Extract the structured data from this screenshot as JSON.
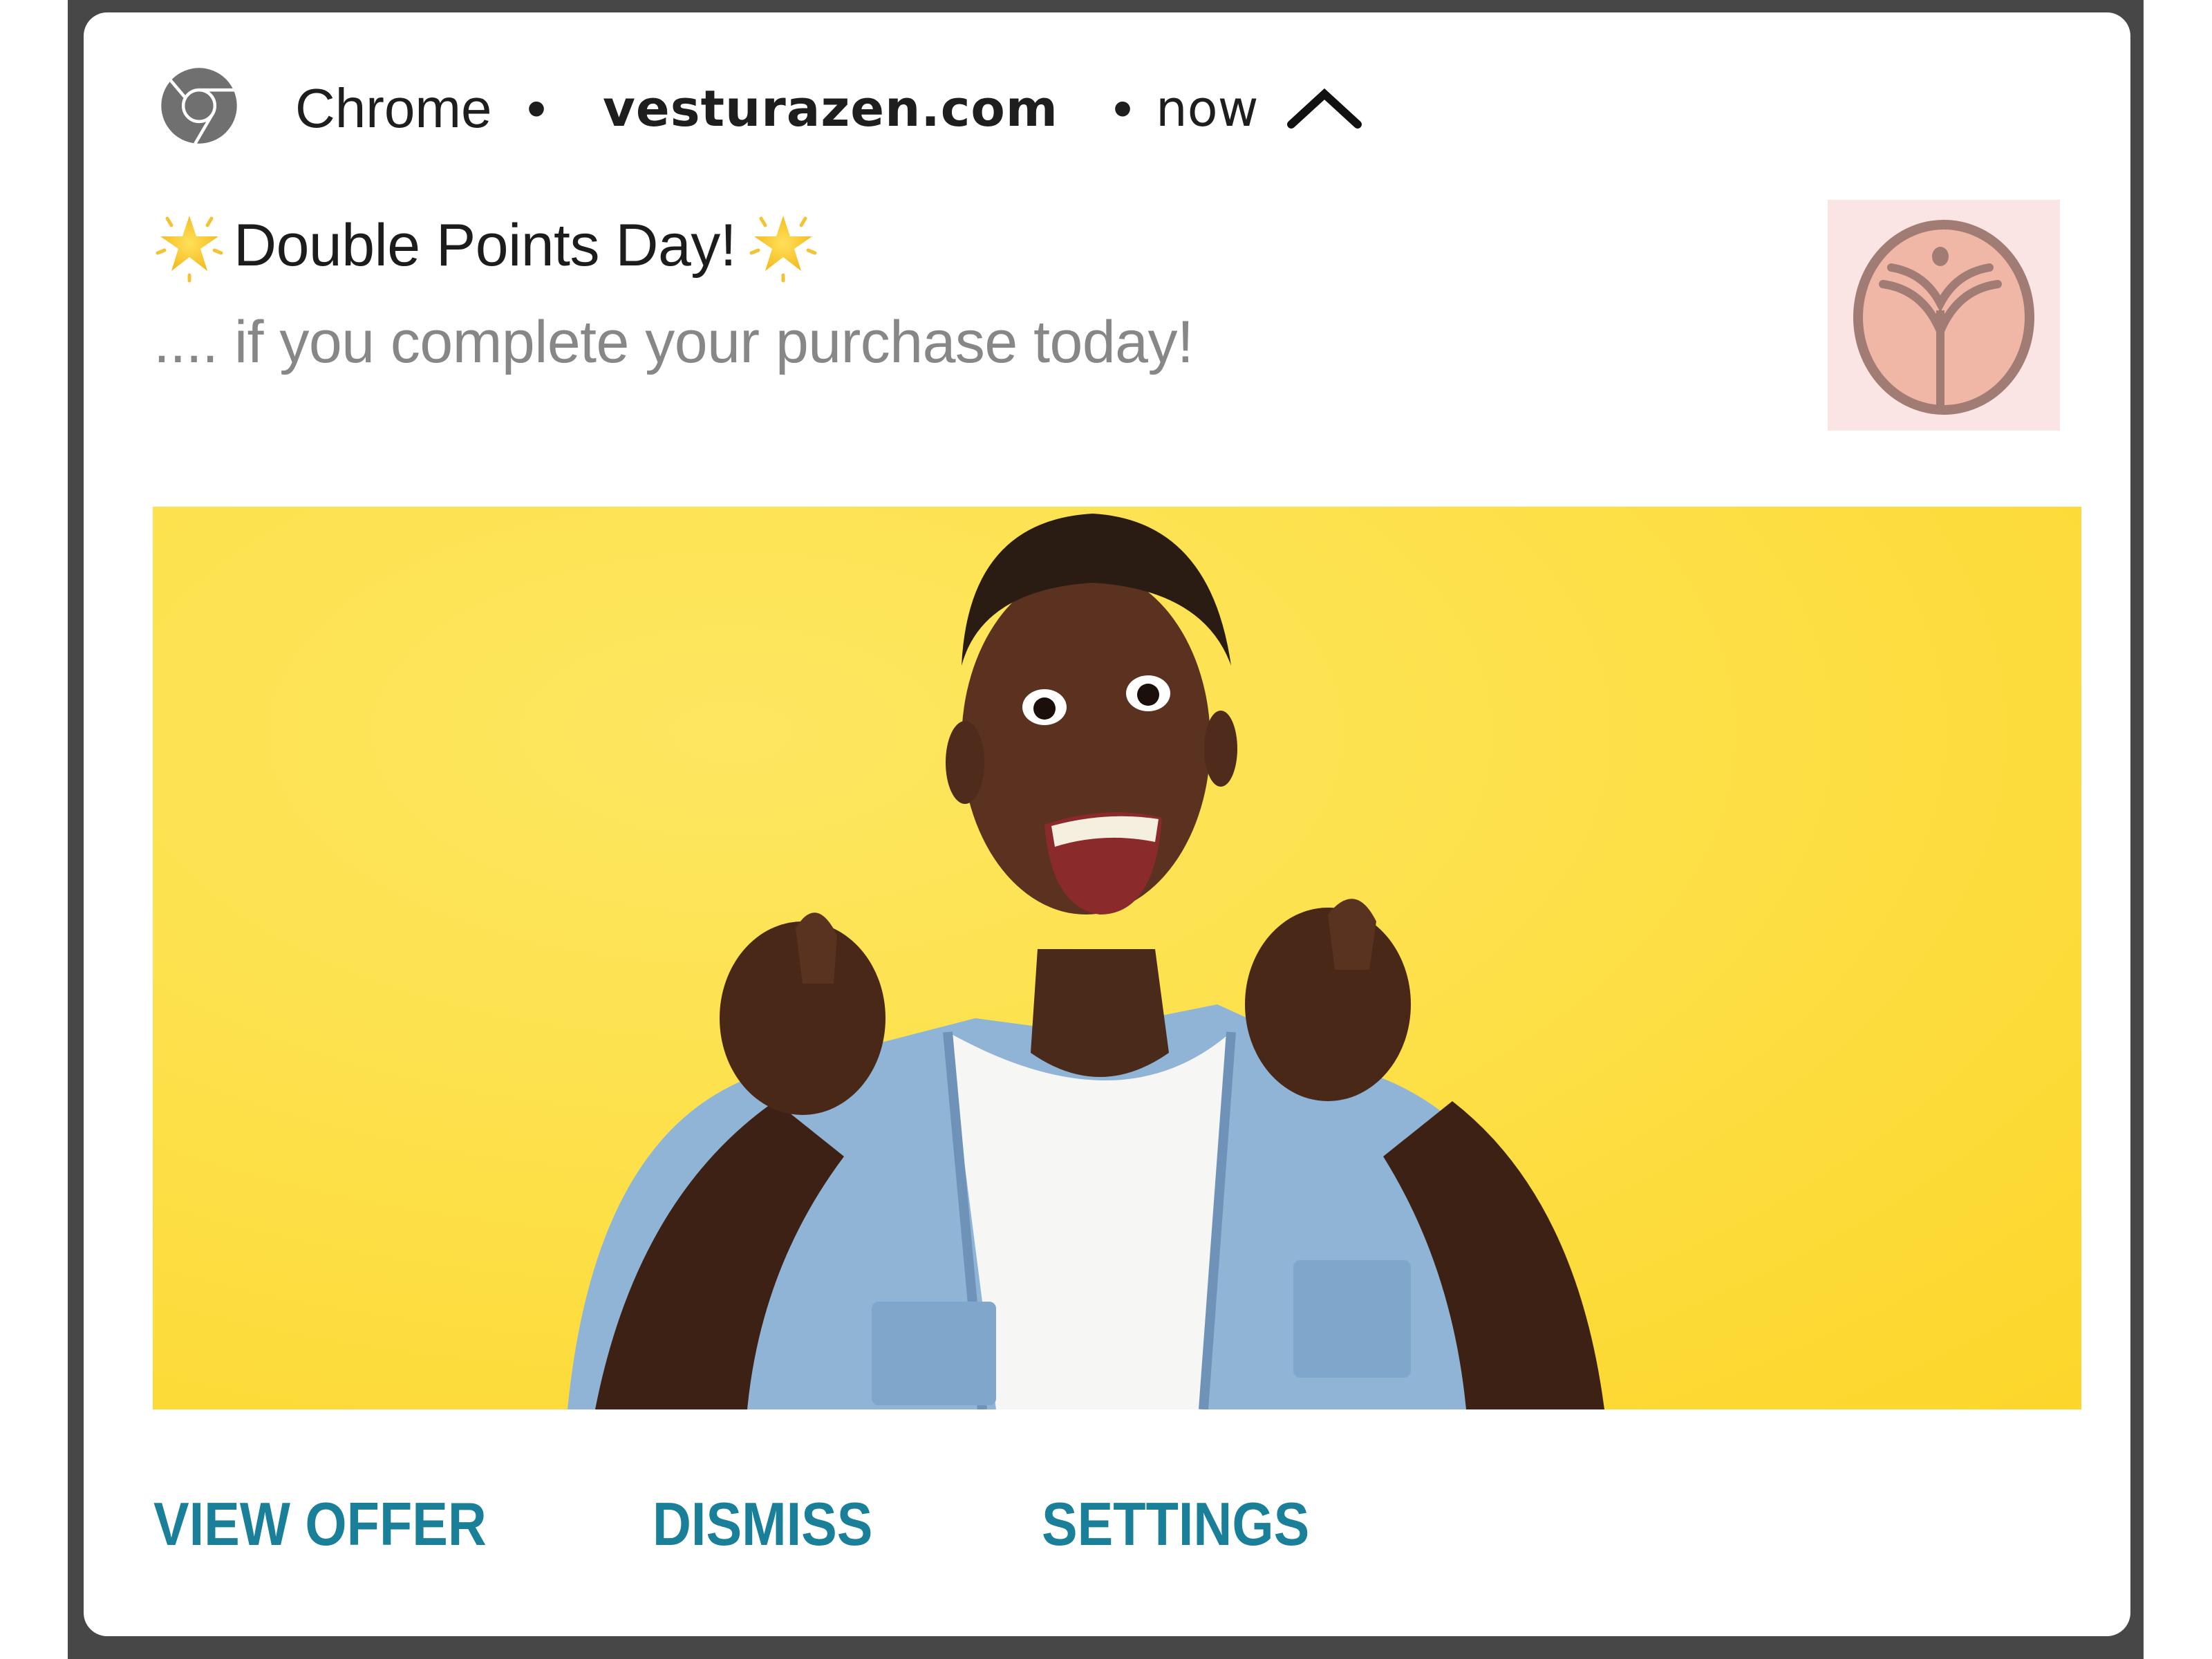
{
  "notification": {
    "app_icon": "chrome-icon",
    "app_name": "Chrome",
    "separator": "•",
    "site": "vesturazen.com",
    "time": "now",
    "collapse_icon": "chevron-up-icon",
    "title_prefix_icon": "glowing-star-emoji",
    "title": "Double Points Day!",
    "title_suffix_icon": "glowing-star-emoji",
    "body": ".... if you complete your purchase today!",
    "large_icon": "vesturazen-tree-logo",
    "image": {
      "description": "Excited man in denim shirt pointing at viewer on yellow background",
      "background_color": "#fde04a"
    },
    "actions": [
      {
        "label": "VIEW OFFER"
      },
      {
        "label": "DISMISS"
      },
      {
        "label": "SETTINGS"
      }
    ]
  },
  "colors": {
    "frame": "#474747",
    "card": "#ffffff",
    "action_text": "#1a7f98",
    "title_text": "#1c1c1c",
    "body_text": "#878787",
    "logo_bg": "#fbe4e4",
    "logo_fill": "#f0b8a8",
    "logo_stroke": "#a07c74"
  }
}
